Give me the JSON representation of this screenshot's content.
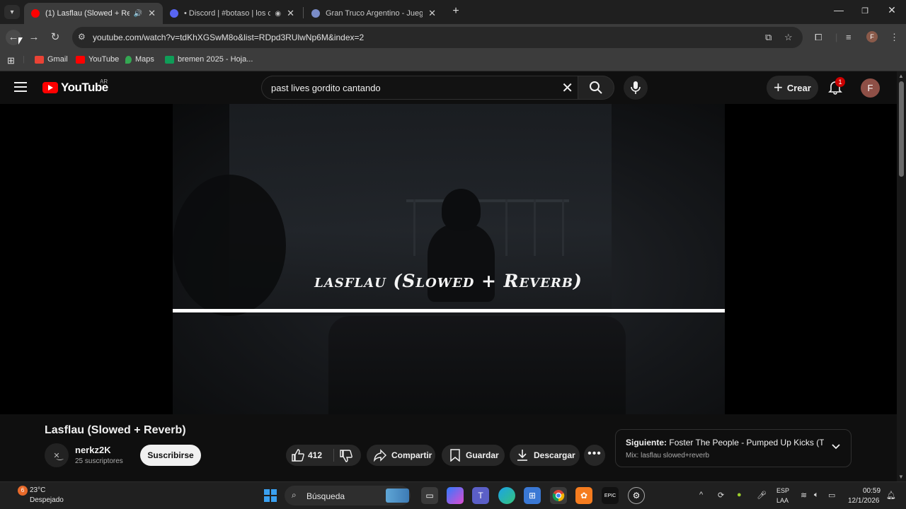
{
  "browser": {
    "tabs": [
      {
        "title": "(1) Lasflau (Slowed + Reverb",
        "active": true,
        "favicon_color": "#ff0000"
      },
      {
        "title": "• Discord | #botaso | los cor",
        "active": false,
        "favicon_color": "#5865f2"
      },
      {
        "title": "Gran Truco Argentino - Juego C",
        "active": false,
        "favicon_color": "#7a8cc8"
      }
    ],
    "url": "youtube.com/watch?v=tdKhXGSwM8o&list=RDpd3RUlwNp6M&index=2",
    "bookmarks": [
      {
        "label": "Gmail",
        "color": "#ea4335"
      },
      {
        "label": "YouTube",
        "color": "#ff0000"
      },
      {
        "label": "Maps",
        "color": "#34a853"
      },
      {
        "label": "bremen 2025 - Hoja...",
        "color": "#0f9d58"
      }
    ],
    "profile_initial": "F"
  },
  "youtube": {
    "logo_text": "YouTube",
    "country_code": "AR",
    "search_query": "past lives gordito cantando",
    "create_label": "Crear",
    "notification_count": "1",
    "avatar_initial": "F",
    "video_overlay_title": "lasflau (Slowed + Reverb)",
    "video_title": "Lasflau (Slowed + Reverb)",
    "channel_name": "nerkz2K",
    "subscribers": "25 suscriptores",
    "subscribe_label": "Suscribirse",
    "likes": "412",
    "share_label": "Compartir",
    "save_label": "Guardar",
    "download_label": "Descargar",
    "next_prefix": "Siguiente:",
    "next_title": "Foster The People - Pumped Up Kicks (Tr...",
    "next_mix": "Mix: lasflau slowed+reverb"
  },
  "taskbar": {
    "temperature": "23°C",
    "condition": "Despejado",
    "weather_badge": "6",
    "search_label": "Búsqueda",
    "lang_line1": "ESP",
    "lang_line2": "LAA",
    "time": "00:59",
    "date": "12/1/2026"
  }
}
